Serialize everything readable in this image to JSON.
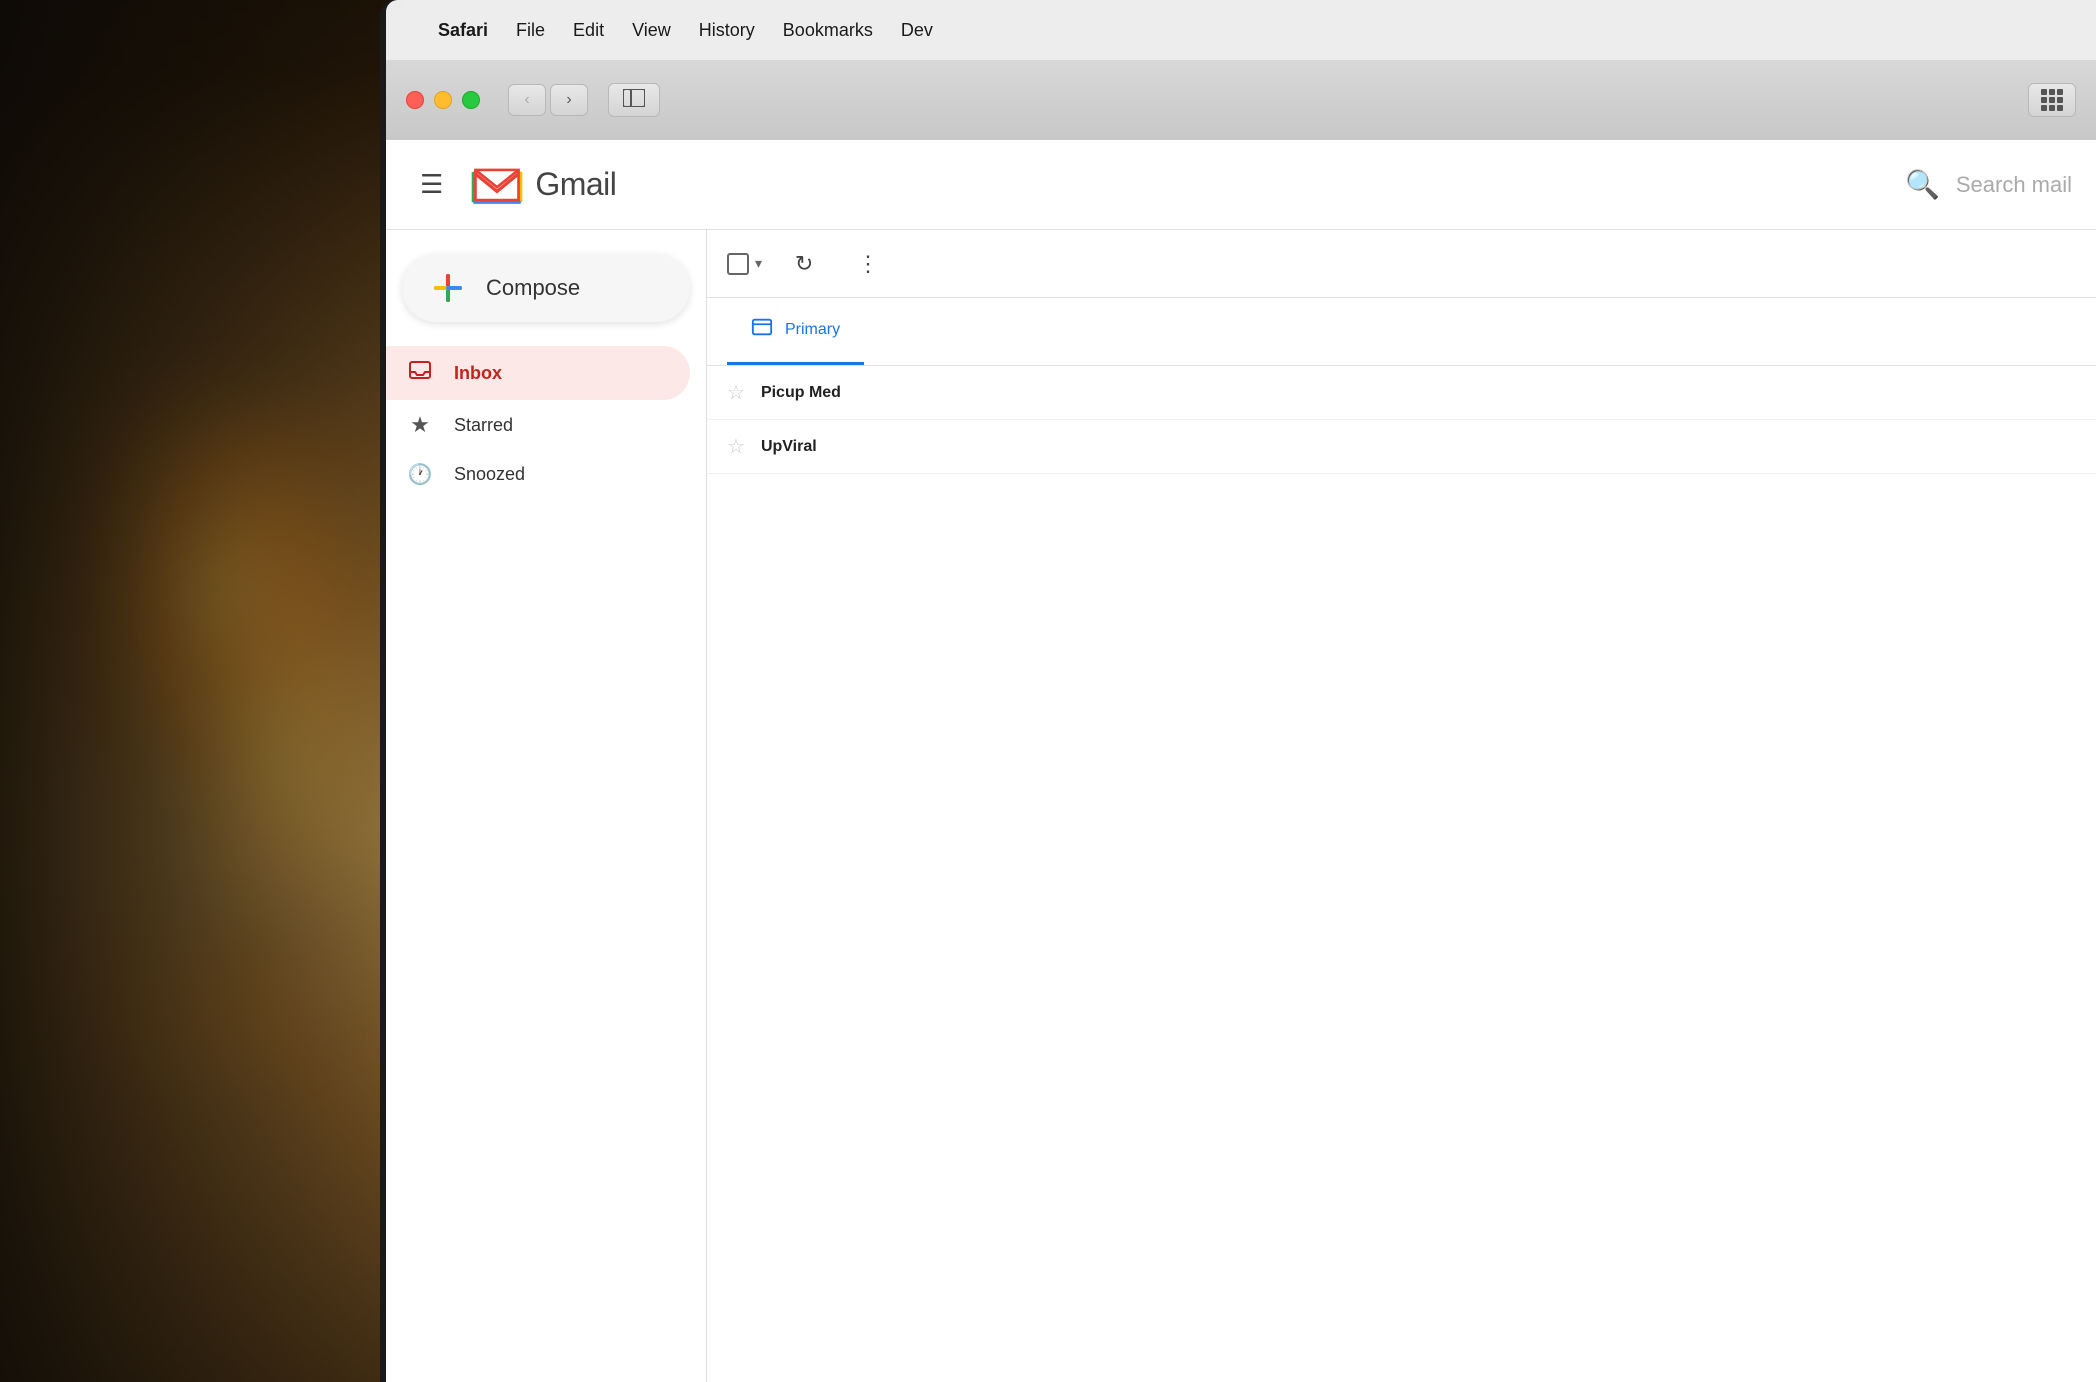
{
  "background": {
    "description": "bokeh background with warm light"
  },
  "menubar": {
    "apple_label": "",
    "items": [
      {
        "id": "safari",
        "label": "Safari",
        "bold": true
      },
      {
        "id": "file",
        "label": "File",
        "bold": false
      },
      {
        "id": "edit",
        "label": "Edit",
        "bold": false
      },
      {
        "id": "view",
        "label": "View",
        "bold": false
      },
      {
        "id": "history",
        "label": "History",
        "bold": false
      },
      {
        "id": "bookmarks",
        "label": "Bookmarks",
        "bold": false
      },
      {
        "id": "dev",
        "label": "Dev",
        "bold": false
      }
    ]
  },
  "browser": {
    "back_btn": "‹",
    "forward_btn": "›",
    "sidebar_icon": "⊞",
    "grid_icon": "grid"
  },
  "gmail": {
    "hamburger": "☰",
    "logo_text": "Gmail",
    "search_placeholder": "Search mail",
    "compose_label": "Compose",
    "nav_items": [
      {
        "id": "inbox",
        "label": "Inbox",
        "icon": "📥",
        "active": true
      },
      {
        "id": "starred",
        "label": "Starred",
        "icon": "★",
        "active": false
      },
      {
        "id": "snoozed",
        "label": "Snoozed",
        "icon": "🕐",
        "active": false
      }
    ],
    "tabs": [
      {
        "id": "primary",
        "label": "Primary",
        "icon": "🖥",
        "active": true
      }
    ],
    "emails": [
      {
        "id": "1",
        "sender": "Picup Med",
        "subject": ""
      },
      {
        "id": "2",
        "sender": "UpViral",
        "subject": ""
      }
    ]
  }
}
